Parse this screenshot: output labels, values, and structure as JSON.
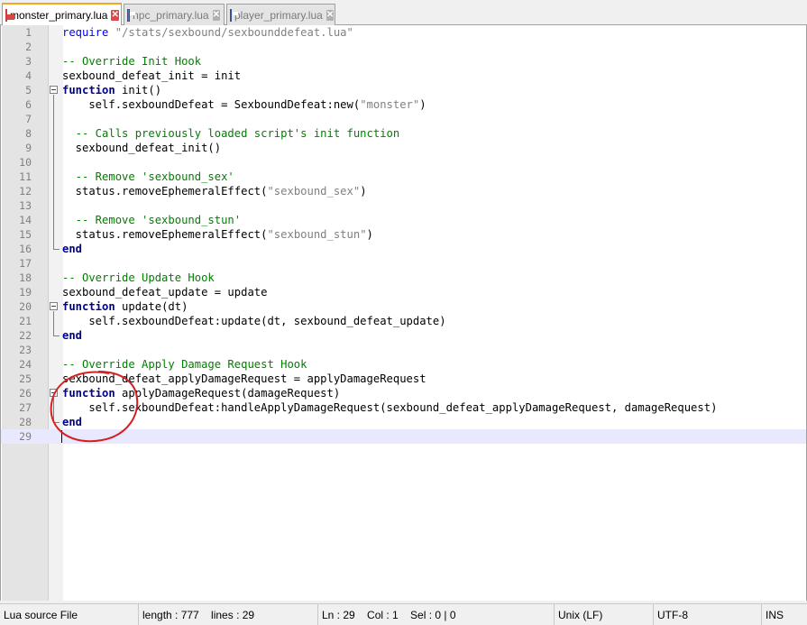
{
  "tabs": [
    {
      "label": "monster_primary.lua",
      "active": true,
      "icon": "lua-file-icon"
    },
    {
      "label": "npc_primary.lua",
      "active": false,
      "icon": "lua-file-icon"
    },
    {
      "label": "player_primary.lua",
      "active": false,
      "icon": "lua-file-icon"
    }
  ],
  "editor": {
    "line_numbers": [
      "1",
      "2",
      "3",
      "4",
      "5",
      "6",
      "7",
      "8",
      "9",
      "10",
      "11",
      "12",
      "13",
      "14",
      "15",
      "16",
      "17",
      "18",
      "19",
      "20",
      "21",
      "22",
      "23",
      "24",
      "25",
      "26",
      "27",
      "28",
      "29"
    ],
    "lines": {
      "l1_kw": "require",
      "l1_str": " \"/stats/sexbound/sexbounddefeat.lua\"",
      "l3": "-- Override Init Hook",
      "l4": "sexbound_defeat_init = init",
      "l5_kw": "function",
      "l5_rest": " init()",
      "l6_a": "    self.sexboundDefeat = SexboundDefeat:new(",
      "l6_str": "\"monster\"",
      "l6_b": ")",
      "l8": "  -- Calls previously loaded script's init function",
      "l9": "  sexbound_defeat_init()",
      "l11": "  -- Remove 'sexbound_sex'",
      "l12_a": "  status.removeEphemeralEffect(",
      "l12_str": "\"sexbound_sex\"",
      "l12_b": ")",
      "l14": "  -- Remove 'sexbound_stun'",
      "l15_a": "  status.removeEphemeralEffect(",
      "l15_str": "\"sexbound_stun\"",
      "l15_b": ")",
      "l16": "end",
      "l18": "-- Override Update Hook",
      "l19": "sexbound_defeat_update = update",
      "l20_kw": "function",
      "l20_rest": " update(dt)",
      "l21": "    self.sexboundDefeat:update(dt, sexbound_defeat_update)",
      "l22": "end",
      "l24": "-- Override Apply Damage Request Hook",
      "l25": "sexbound_defeat_applyDamageRequest = applyDamageRequest",
      "l26_kw": "function",
      "l26_rest": " applyDamageRequest(damageRequest)",
      "l27": "    self.sexboundDefeat:handleApplyDamageRequest(sexbound_defeat_applyDamageRequest, damageRequest)",
      "l28": "end"
    },
    "current_line": 29
  },
  "statusbar": {
    "language": "Lua source File",
    "length_lines": "length : 777    lines : 29",
    "position": "Ln : 29    Col : 1    Sel : 0 | 0",
    "eol": "Unix (LF)",
    "encoding": "UTF-8",
    "mode": "INS"
  },
  "colors": {
    "keyword": "#0000ff",
    "comment": "#008000",
    "string": "#808080",
    "annotation": "#d42020",
    "active_tab_accent": "#f5a623"
  }
}
